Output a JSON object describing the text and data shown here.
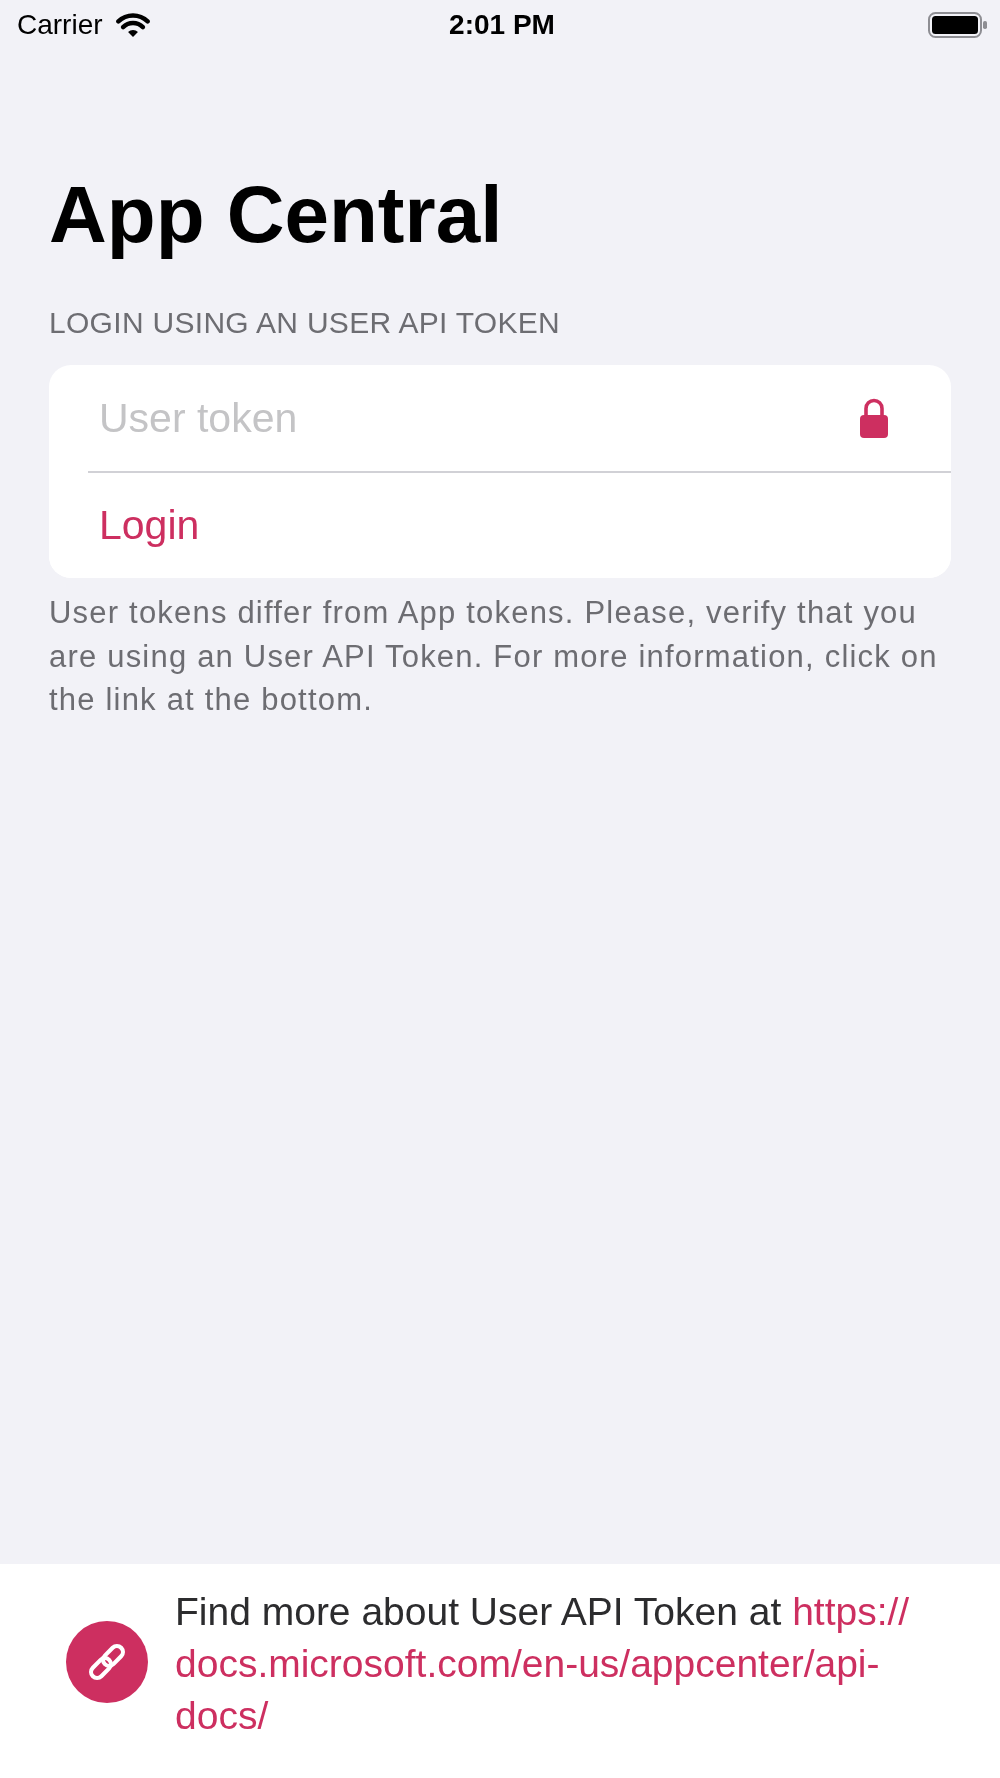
{
  "status_bar": {
    "carrier": "Carrier",
    "time": "2:01 PM"
  },
  "title": "App Central",
  "login_section": {
    "header": "LOGIN USING AN USER API TOKEN",
    "token_field": {
      "placeholder": "User token"
    },
    "login_button": {
      "label": "Login"
    },
    "note": "User tokens differ from App tokens. Please, verify that you are using an User API Token. For more information, click on the link at the bottom."
  },
  "docs_footer": {
    "text": "Find more about User API Token at",
    "link": "https://docs.microsoft.com/en-us/appcenter/api-docs/"
  }
}
